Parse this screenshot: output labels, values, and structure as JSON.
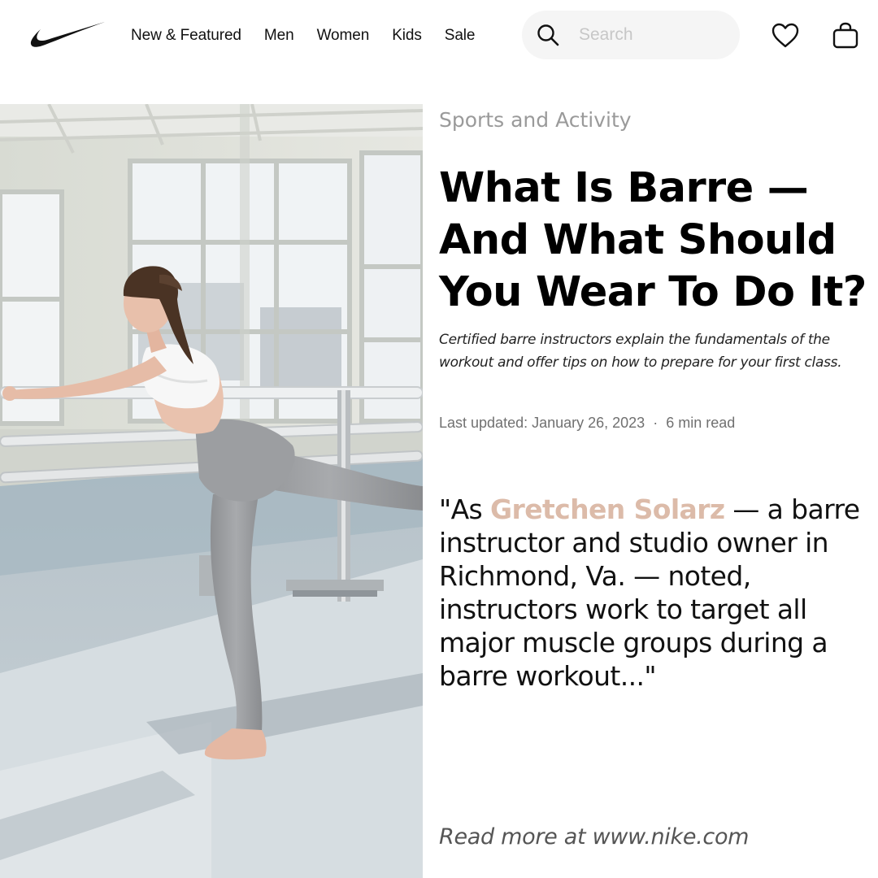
{
  "header": {
    "logo_icon": "nike-swoosh-icon",
    "nav": [
      "New & Featured",
      "Men",
      "Women",
      "Kids",
      "Sale"
    ],
    "search": {
      "placeholder": "Search",
      "icon": "search-icon"
    },
    "favorites_icon": "heart-icon",
    "bag_icon": "shopping-bag-icon"
  },
  "hero": {
    "alt": "Woman stretching at a barre in a bright studio"
  },
  "article": {
    "category": "Sports and Activity",
    "title": "What Is Barre — And What Should You Wear To Do It?",
    "subtitle": "Certified barre instructors explain the fundamentals of the workout and offer tips on how to prepare for your first class.",
    "last_updated": "Last updated: January 26, 2023",
    "separator": "·",
    "read_time": "6 min read",
    "quote": {
      "open": "\"As ",
      "name": "Gretchen Solarz",
      "rest": " — a barre instructor and studio owner in Richmond, Va. — noted, instructors work to target all major muscle groups during a barre workout...\""
    },
    "read_more": "Read more at www.nike.com"
  },
  "colors": {
    "accent_name": "#dcbba9",
    "search_bg": "#f5f5f5",
    "muted": "#9a9a9a"
  }
}
